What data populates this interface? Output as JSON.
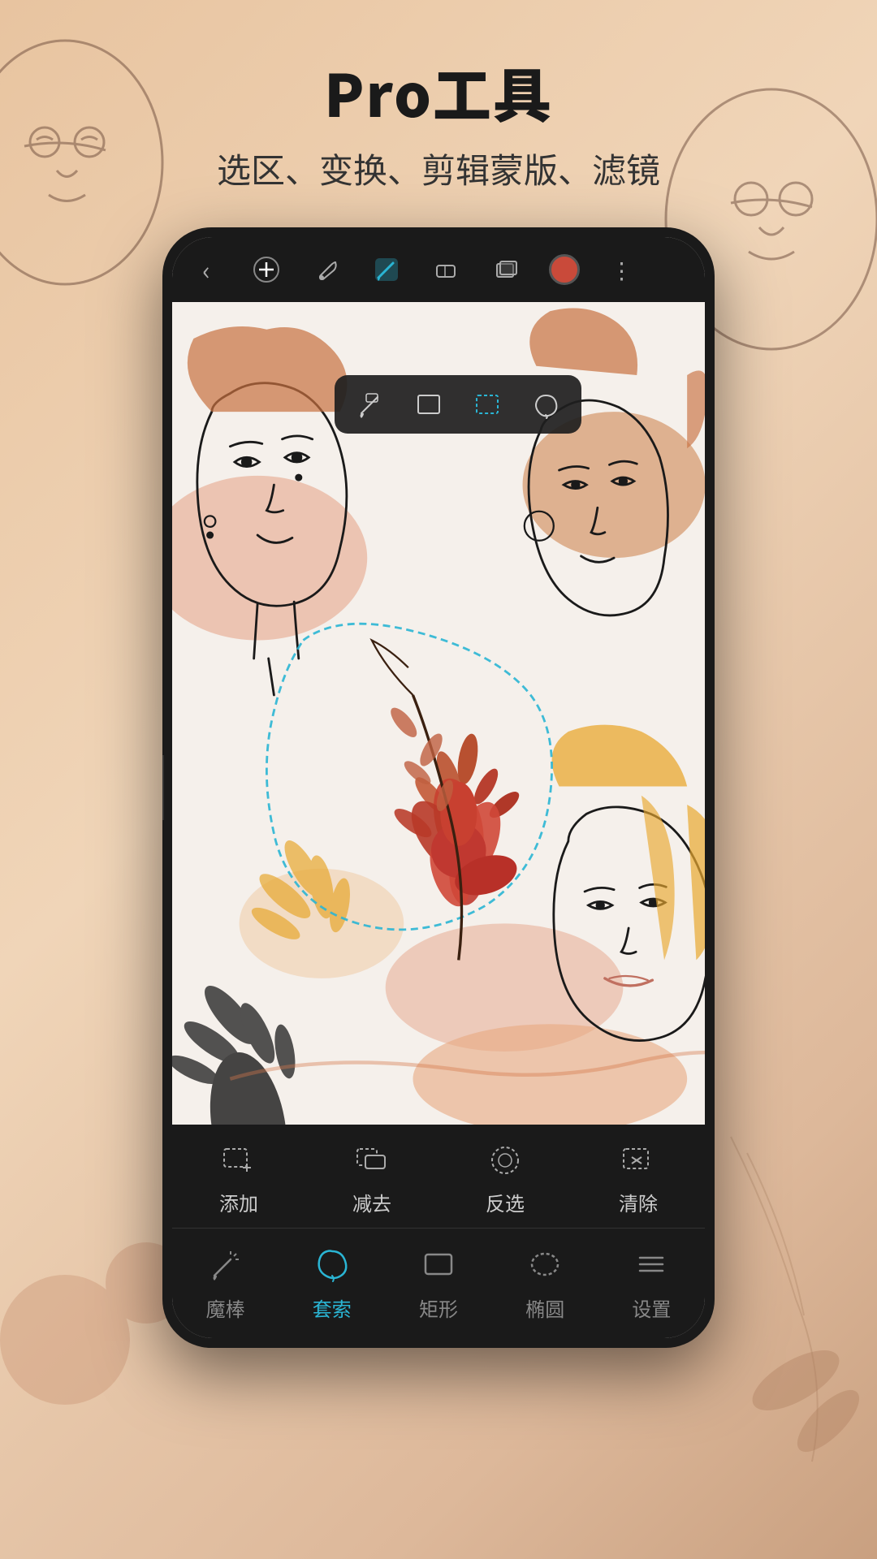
{
  "header": {
    "main_title": "Pro工具",
    "sub_title": "选区、变换、剪辑蒙版、滤镜"
  },
  "toolbar": {
    "back_icon": "‹",
    "add_icon": "+",
    "wrench_icon": "🔧",
    "eraser_icon": "⬜",
    "layers_icon": "◧",
    "more_icon": "⋮"
  },
  "selection_menu": {
    "icons": [
      "magic_wand",
      "rectangle",
      "rect_dashed",
      "lasso"
    ]
  },
  "selection_actions": [
    {
      "label": "添加",
      "icon": "add_sel"
    },
    {
      "label": "减去",
      "icon": "subtract_sel"
    },
    {
      "label": "反选",
      "icon": "invert_sel"
    },
    {
      "label": "清除",
      "icon": "clear_sel"
    }
  ],
  "tool_tabs": [
    {
      "label": "魔棒",
      "icon": "magic_wand",
      "active": false
    },
    {
      "label": "套索",
      "icon": "lasso",
      "active": true
    },
    {
      "label": "矩形",
      "icon": "rectangle",
      "active": false
    },
    {
      "label": "椭圆",
      "icon": "ellipse",
      "active": false
    },
    {
      "label": "设置",
      "icon": "settings",
      "active": false
    }
  ],
  "colors": {
    "background": "#e8c4a0",
    "phone_body": "#1a1a1a",
    "accent_teal": "#2ab5d4",
    "accent_red": "#c94a3a",
    "text_dark": "#1a1a1a"
  }
}
